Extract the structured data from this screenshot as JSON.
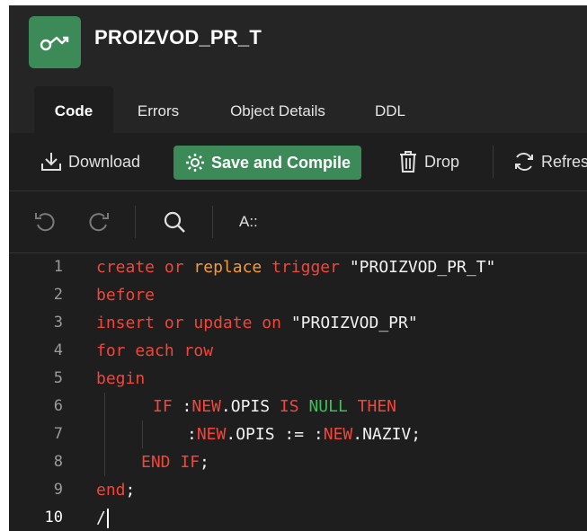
{
  "header": {
    "title": "PROIZVOD_PR_T",
    "icon": "trigger-icon"
  },
  "tabs": [
    {
      "label": "Code",
      "active": true
    },
    {
      "label": "Errors",
      "active": false
    },
    {
      "label": "Object Details",
      "active": false
    },
    {
      "label": "DDL",
      "active": false
    }
  ],
  "toolbar": {
    "download_label": "Download",
    "save_label": "Save and Compile",
    "drop_label": "Drop",
    "refresh_label": "Refres"
  },
  "editor": {
    "font_button_label": "A::",
    "line_numbers": [
      "1",
      "2",
      "3",
      "4",
      "5",
      "6",
      "7",
      "8",
      "9",
      "10"
    ],
    "lines": {
      "l1": {
        "kw1": "create",
        "kw2": "or",
        "plain1": "replace",
        "kw3": "trigger",
        "str": "\"PROIZVOD_PR_T\""
      },
      "l2": {
        "kw1": "before"
      },
      "l3": {
        "kw1": "insert",
        "kw2": "or",
        "kw3": "update",
        "kw4": "on",
        "str": "\"PROIZVOD_PR\""
      },
      "l4": {
        "kw1": "for",
        "kw2": "each",
        "kw3": "row"
      },
      "l5": {
        "kw1": "begin"
      },
      "l6": {
        "kw1": "IF",
        "p1": ":",
        "kw2": "NEW",
        "p2": ".OPIS",
        "kw3": "IS",
        "null": "NULL",
        "kw4": "THEN"
      },
      "l7": {
        "p1": ":",
        "kw1": "NEW",
        "p2": ".OPIS := :",
        "kw2": "NEW",
        "p3": ".NAZIV;"
      },
      "l8": {
        "kw1": "END",
        "kw2": "IF",
        "p1": ";"
      },
      "l9": {
        "kw1": "end",
        "p1": ";"
      },
      "l10": {
        "p1": "/"
      }
    }
  },
  "colors": {
    "accent": "#3b8a57",
    "keyword": "#f2463a",
    "null_keyword": "#3fbf5a",
    "background": "#1e1e1e"
  }
}
